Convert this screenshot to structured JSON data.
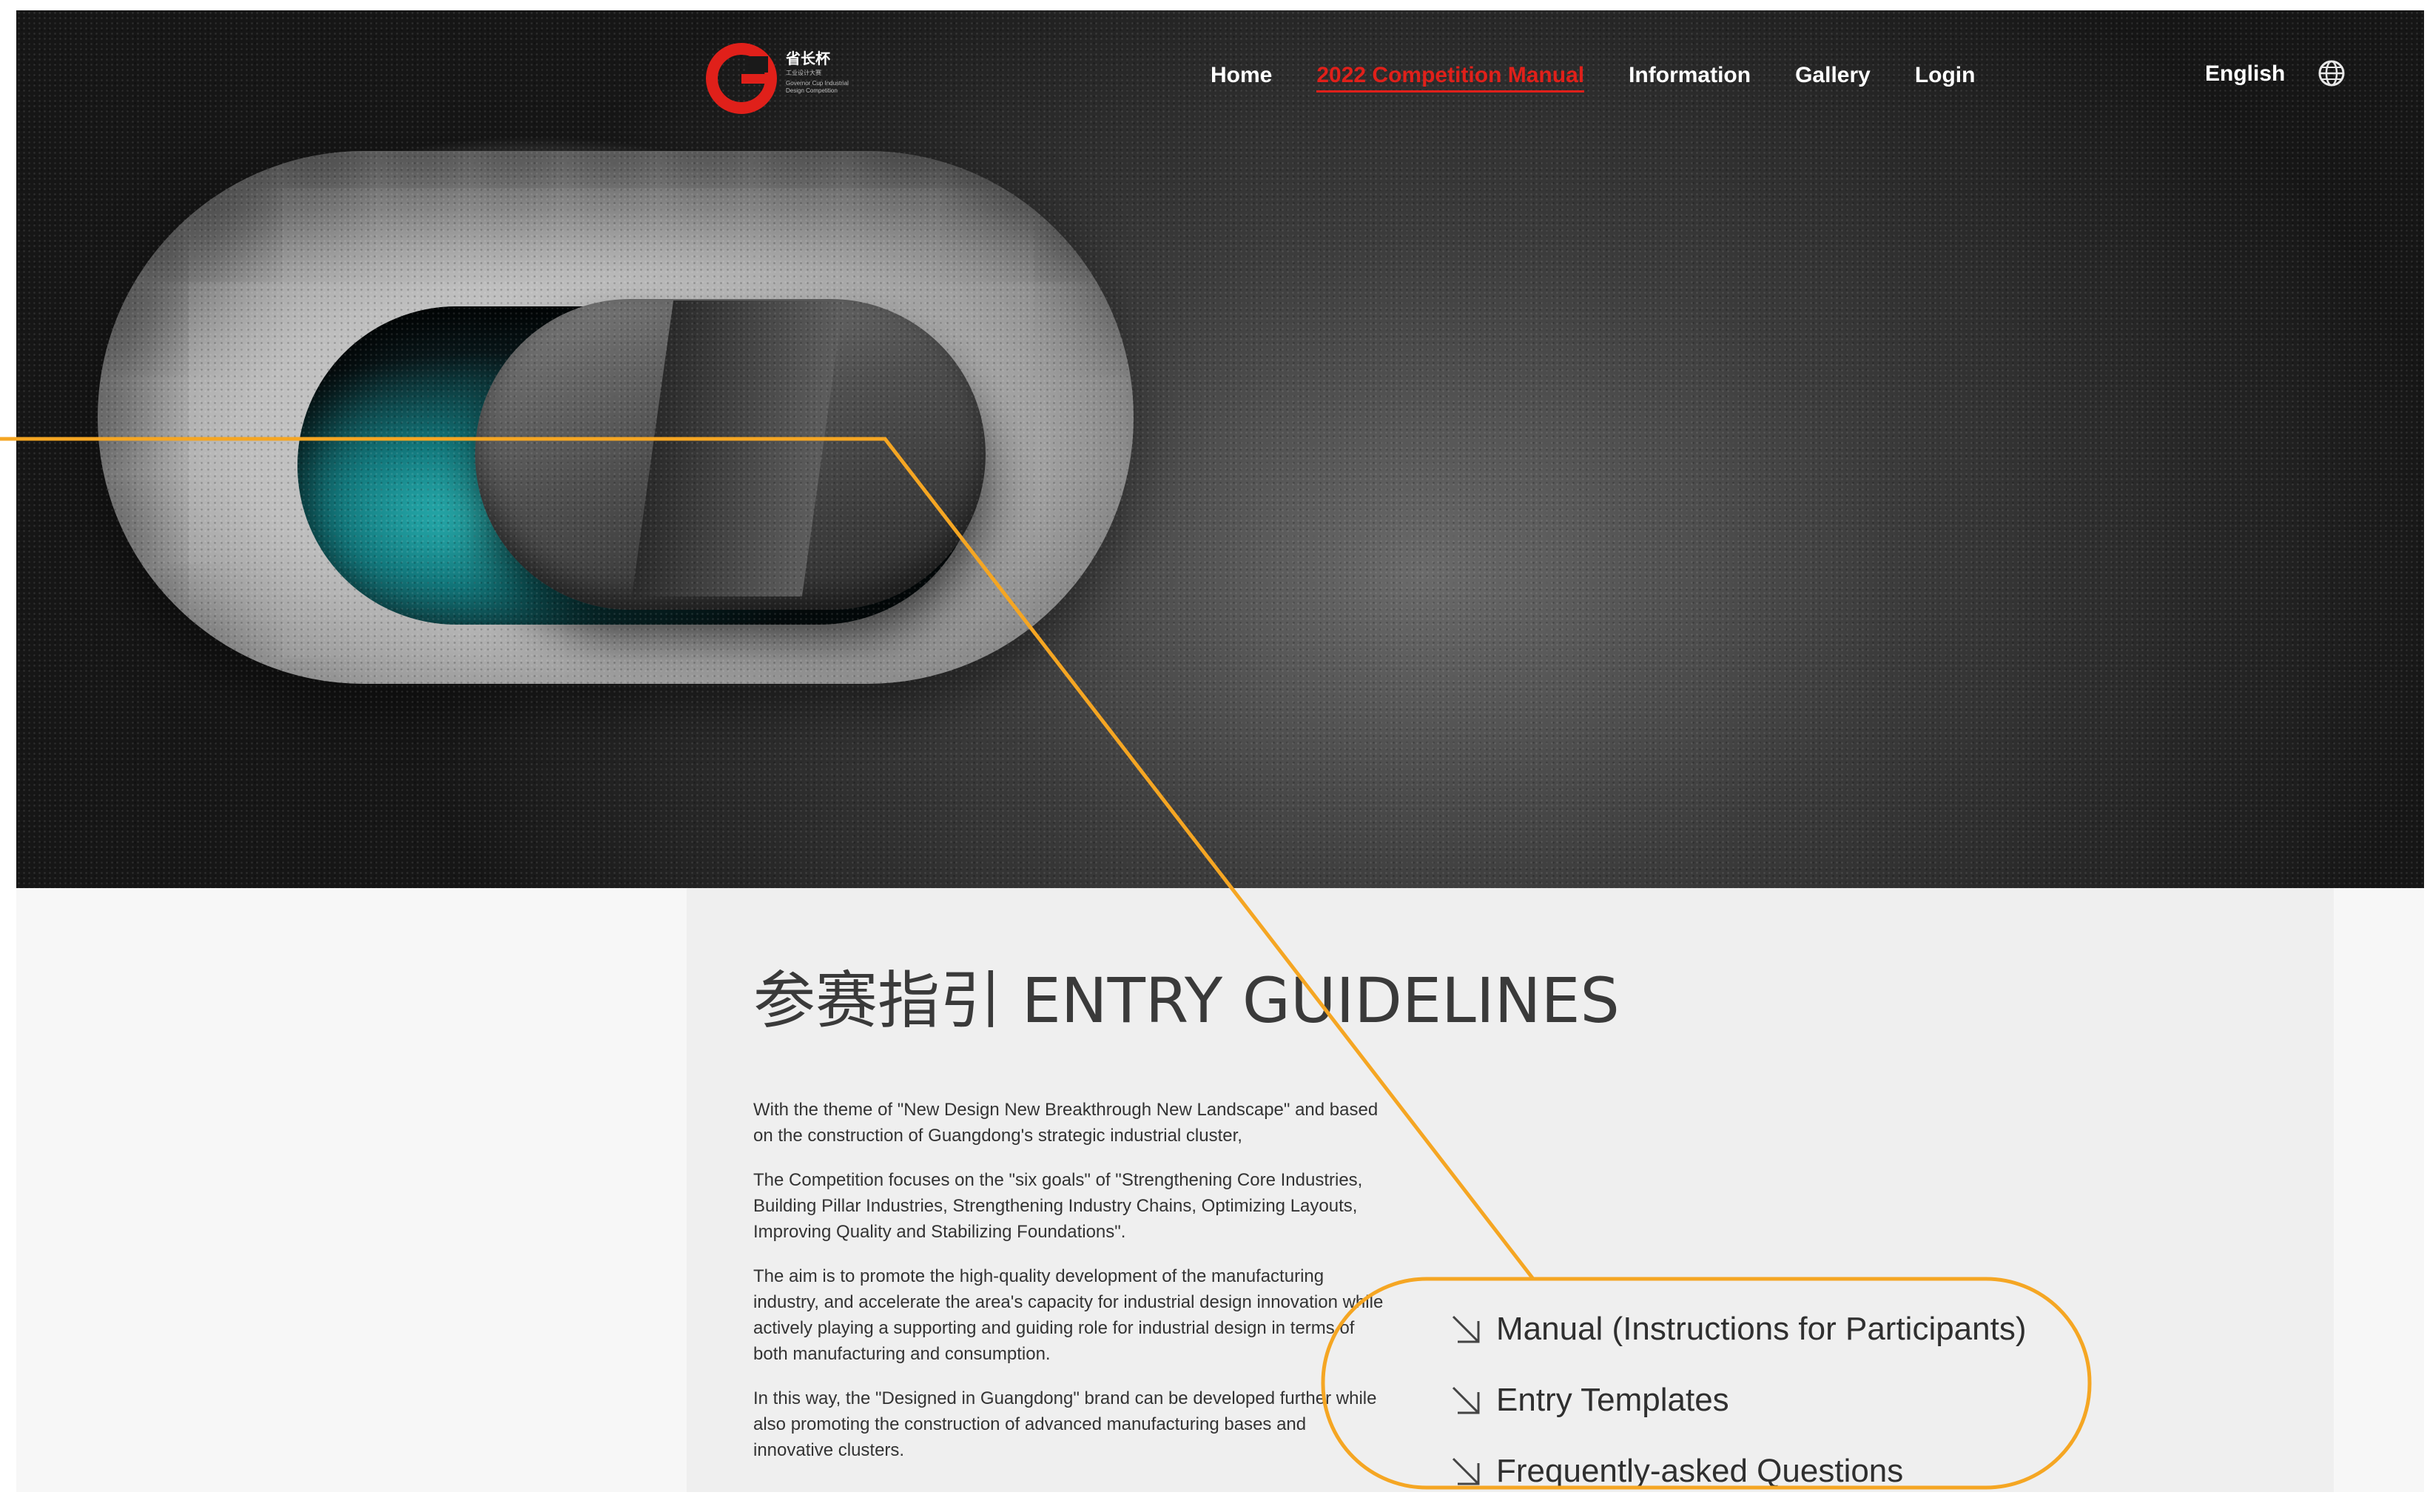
{
  "nav": {
    "logo_cn": "省长杯",
    "logo_sub_cn": "工业设计大赛",
    "logo_en": "Governor Cup Industrial Design Competition",
    "items": [
      {
        "label": "Home",
        "active": false
      },
      {
        "label": "2022 Competition Manual",
        "active": true
      },
      {
        "label": "Information",
        "active": false
      },
      {
        "label": "Gallery",
        "active": false
      },
      {
        "label": "Login",
        "active": false
      }
    ],
    "language": "English"
  },
  "main": {
    "title": "参赛指引 ENTRY GUIDELINES",
    "paragraphs": [
      "With the theme of \"New Design New Breakthrough New Landscape\" and based on the construction of Guangdong's strategic industrial cluster,",
      "The Competition focuses on the \"six goals\" of \"Strengthening Core Industries, Building Pillar Industries, Strengthening Industry Chains, Optimizing Layouts, Improving Quality and Stabilizing Foundations\".",
      "The aim is to promote the high-quality development of the manufacturing industry, and accelerate the area's capacity for industrial design innovation while actively playing a supporting and guiding role for industrial design in terms of both manufacturing and consumption.",
      "In this way, the \"Designed in Guangdong\" brand can be developed further while also promoting the construction of advanced manufacturing bases and innovative clusters."
    ],
    "links": [
      {
        "label": "Manual (Instructions for Participants)"
      },
      {
        "label": "Entry Templates"
      },
      {
        "label": "Frequently-asked Questions"
      }
    ]
  },
  "colors": {
    "accent_red": "#e0201a",
    "annotation_orange": "#f5a623"
  },
  "icons": [
    "logo-mark-icon",
    "globe-icon",
    "arrow-down-right-icon"
  ]
}
